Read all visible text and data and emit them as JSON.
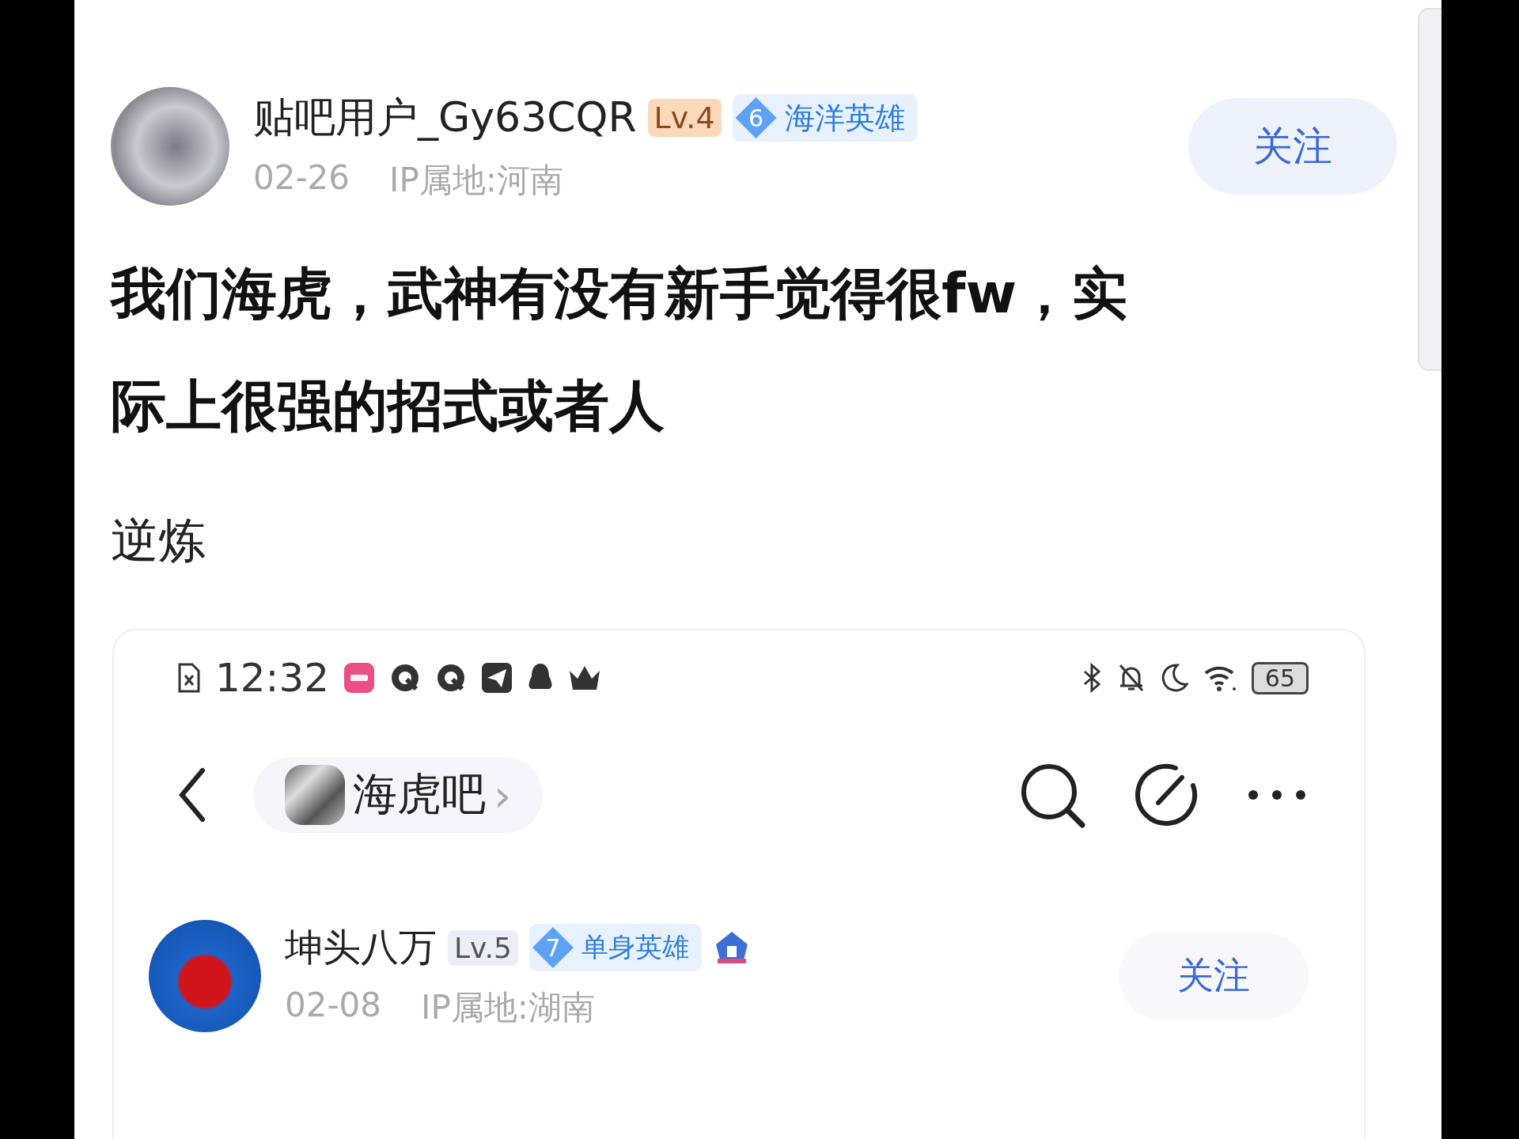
{
  "post": {
    "author": {
      "name": "贴吧用户_Gy63CQR",
      "level": "Lv.4",
      "badge_number": "6",
      "badge_title": "海洋英雄"
    },
    "date": "02-26",
    "ip": "IP属地:河南",
    "follow_label": "关注",
    "title": "我们海虎，武神有没有新手觉得很fw，实际上很强的招式或者人",
    "body": "逆炼"
  },
  "embedded_screenshot": {
    "status_bar": {
      "time": "12:32",
      "battery": "65"
    },
    "nav": {
      "forum": "海虎吧",
      "chevron": "›"
    },
    "author": {
      "name": "坤头八万",
      "level": "Lv.5",
      "badge_number": "7",
      "badge_title": "单身英雄"
    },
    "date": "02-08",
    "ip": "IP属地:湖南",
    "follow_label": "关注"
  }
}
